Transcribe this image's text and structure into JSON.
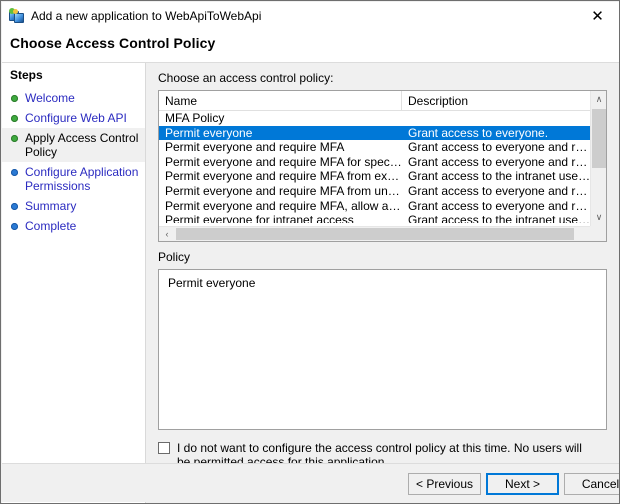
{
  "window": {
    "title": "Add a new application to WebApiToWebApi",
    "icon": "adfs-application-icon",
    "close_label": "✕"
  },
  "header": {
    "page_title": "Choose Access Control Policy"
  },
  "sidebar": {
    "title": "Steps",
    "items": [
      {
        "label": "Welcome",
        "state": "done"
      },
      {
        "label": "Configure Web API",
        "state": "done"
      },
      {
        "label": "Apply Access Control Policy",
        "state": "current"
      },
      {
        "label": "Configure Application Permissions",
        "state": "todo"
      },
      {
        "label": "Summary",
        "state": "todo"
      },
      {
        "label": "Complete",
        "state": "todo"
      }
    ]
  },
  "main": {
    "list_label": "Choose an access control policy:",
    "columns": {
      "name": "Name",
      "description": "Description"
    },
    "rows": [
      {
        "name": "MFA Policy",
        "description": "",
        "selected": false
      },
      {
        "name": "Permit everyone",
        "description": "Grant access to everyone.",
        "selected": true
      },
      {
        "name": "Permit everyone and require MFA",
        "description": "Grant access to everyone and require MFA f...",
        "selected": false
      },
      {
        "name": "Permit everyone and require MFA for specific group",
        "description": "Grant access to everyone and require MFA f...",
        "selected": false
      },
      {
        "name": "Permit everyone and require MFA from extranet access",
        "description": "Grant access to the intranet users and requir...",
        "selected": false
      },
      {
        "name": "Permit everyone and require MFA from unauthenticated ...",
        "description": "Grant access to everyone and require MFA f...",
        "selected": false
      },
      {
        "name": "Permit everyone and require MFA, allow automatic devi...",
        "description": "Grant access to everyone and require MFA f...",
        "selected": false
      },
      {
        "name": "Permit everyone for intranet access",
        "description": "Grant access to the intranet users.",
        "selected": false
      }
    ],
    "policy_label": "Policy",
    "policy_text": "Permit everyone",
    "optout_checkbox": {
      "checked": false,
      "label": "I do not want to configure the access control policy at this time.  No users will be permitted access for this application."
    },
    "scroll": {
      "up_arrow": "∧",
      "down_arrow": "∨",
      "left_arrow": "‹",
      "right_arrow": "›"
    }
  },
  "footer": {
    "previous": "< Previous",
    "next": "Next >",
    "cancel": "Cancel"
  },
  "colors": {
    "selection": "#0078D7",
    "window_bg": "#F0F0F0",
    "link": "#2B2BC0",
    "step_done": "#3FAA3F",
    "step_todo": "#2A7AD4"
  }
}
